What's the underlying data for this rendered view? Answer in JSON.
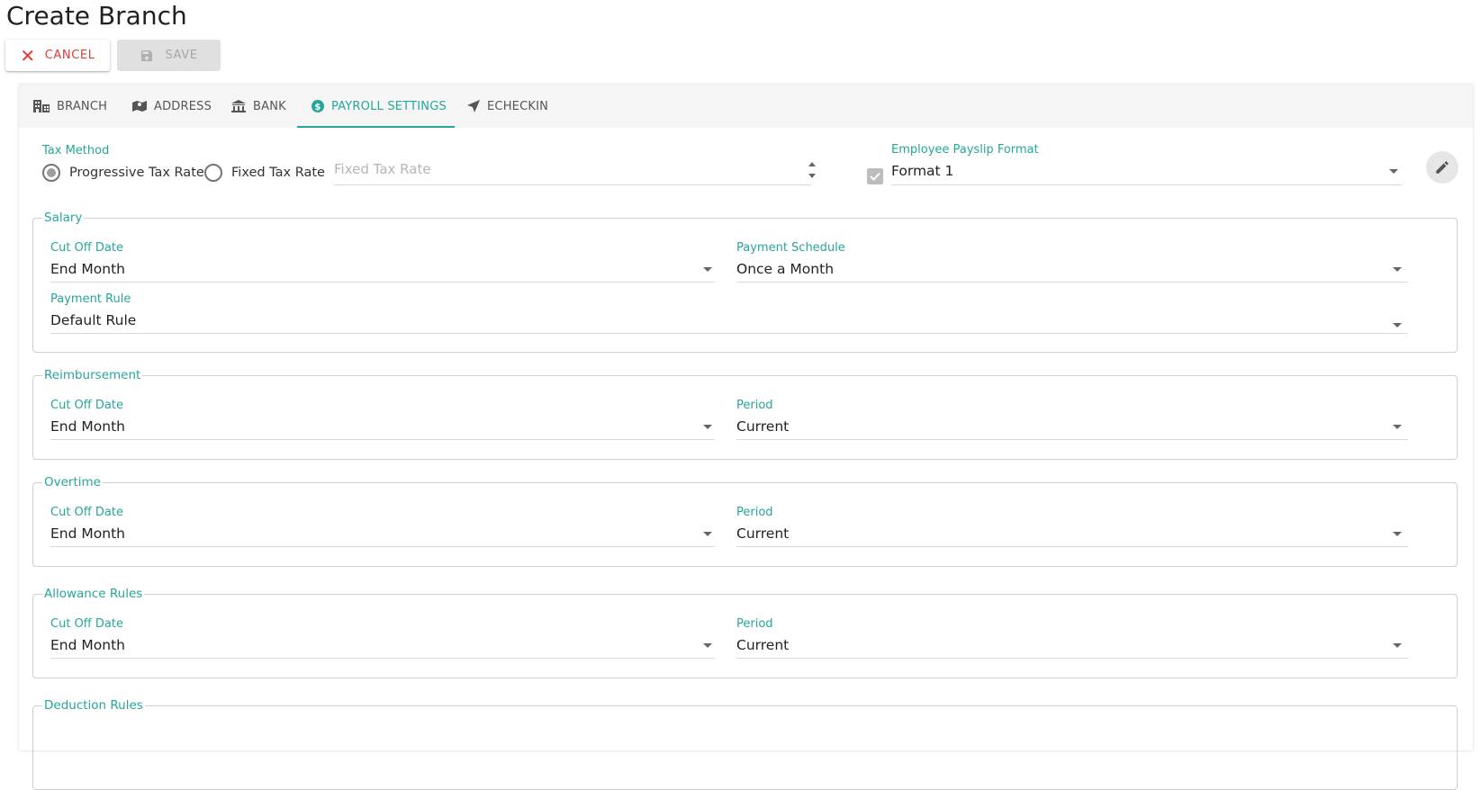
{
  "page": {
    "title": "Create Branch"
  },
  "toolbar": {
    "cancel_label": "CANCEL",
    "save_label": "SAVE"
  },
  "tabs": [
    {
      "label": "BRANCH",
      "icon": "building-icon"
    },
    {
      "label": "ADDRESS",
      "icon": "map-icon"
    },
    {
      "label": "BANK",
      "icon": "bank-icon"
    },
    {
      "label": "PAYROLL SETTINGS",
      "icon": "dollar-circle-icon",
      "active": true
    },
    {
      "label": "ECHECKIN",
      "icon": "navigation-arrow-icon"
    }
  ],
  "tax": {
    "label": "Tax Method",
    "options": [
      "Progressive Tax Rate",
      "Fixed Tax Rate"
    ],
    "selected": "Progressive Tax Rate",
    "fixed_rate_placeholder": "Fixed Tax Rate"
  },
  "payslip": {
    "label": "Employee Payslip Format",
    "value": "Format 1",
    "checked": true
  },
  "sections": {
    "salary": {
      "legend": "Salary",
      "cutoff_label": "Cut Off Date",
      "cutoff_value": "End Month",
      "schedule_label": "Payment Schedule",
      "schedule_value": "Once a Month",
      "rule_label": "Payment Rule",
      "rule_value": "Default Rule"
    },
    "reimbursement": {
      "legend": "Reimbursement",
      "cutoff_label": "Cut Off Date",
      "cutoff_value": "End Month",
      "period_label": "Period",
      "period_value": "Current"
    },
    "overtime": {
      "legend": "Overtime",
      "cutoff_label": "Cut Off Date",
      "cutoff_value": "End Month",
      "period_label": "Period",
      "period_value": "Current"
    },
    "allowance": {
      "legend": "Allowance Rules",
      "cutoff_label": "Cut Off Date",
      "cutoff_value": "End Month",
      "period_label": "Period",
      "period_value": "Current"
    },
    "deduction": {
      "legend": "Deduction Rules"
    }
  },
  "colors": {
    "accent": "#26a69a",
    "cancel": "#e53935"
  }
}
